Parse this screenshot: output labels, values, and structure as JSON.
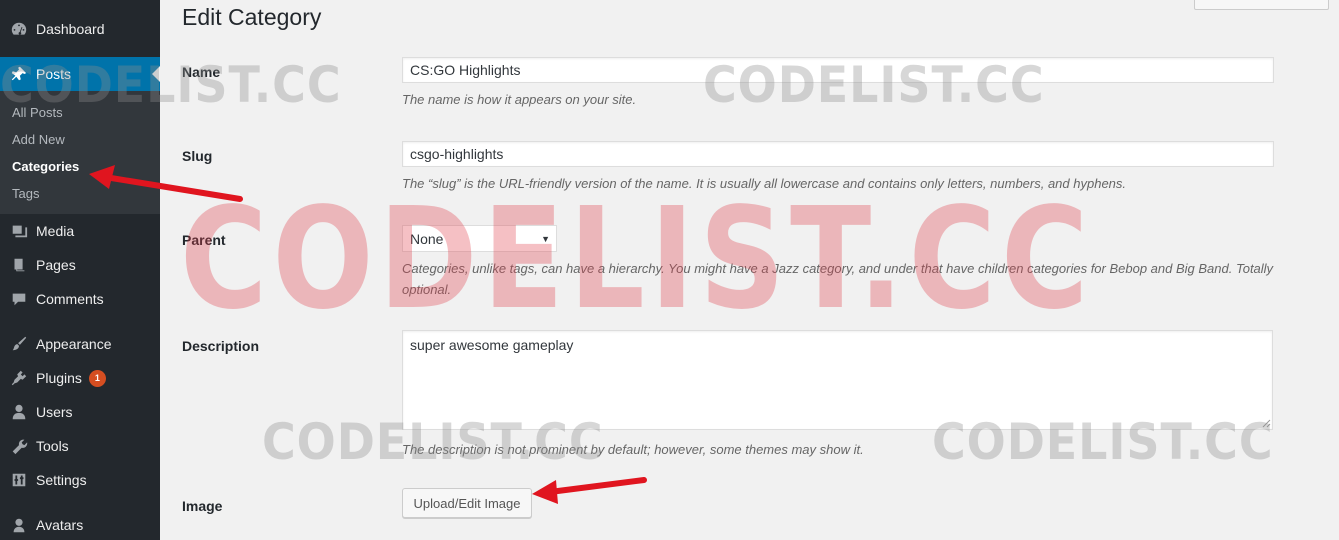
{
  "sidebar": {
    "items": [
      {
        "label": "Dashboard",
        "icon": "dashboard-icon"
      },
      {
        "label": "Posts",
        "icon": "pushpin-icon"
      },
      {
        "label": "Media",
        "icon": "media-icon"
      },
      {
        "label": "Pages",
        "icon": "pages-icon"
      },
      {
        "label": "Comments",
        "icon": "comment-icon"
      },
      {
        "label": "Appearance",
        "icon": "paintbrush-icon"
      },
      {
        "label": "Plugins",
        "icon": "plugin-icon",
        "badge": "1"
      },
      {
        "label": "Users",
        "icon": "user-icon"
      },
      {
        "label": "Tools",
        "icon": "wrench-icon"
      },
      {
        "label": "Settings",
        "icon": "settings-icon"
      },
      {
        "label": "Avatars",
        "icon": "avatar-icon"
      }
    ],
    "submenu": [
      "All Posts",
      "Add New",
      "Categories",
      "Tags"
    ]
  },
  "page": {
    "title": "Edit Category"
  },
  "form": {
    "name_label": "Name",
    "name_value": "CS:GO Highlights",
    "name_help": "The name is how it appears on your site.",
    "slug_label": "Slug",
    "slug_value": "csgo-highlights",
    "slug_help": "The “slug” is the URL-friendly version of the name. It is usually all lowercase and contains only letters, numbers, and hyphens.",
    "parent_label": "Parent",
    "parent_value": "None",
    "parent_help_line1": "Categories, unlike tags, can have a hierarchy. You might have a Jazz category, and under that have children categories for Bebop and Big Band. Totally",
    "parent_help_line2": "optional.",
    "description_label": "Description",
    "description_value": "super awesome gameplay",
    "description_help": "The description is not prominent by default; however, some themes may show it.",
    "image_label": "Image",
    "upload_button": "Upload/Edit Image"
  },
  "watermark": {
    "text": "CODELIST.CC"
  },
  "colors": {
    "sidebar_bg": "#23282d",
    "active_bg": "#0073aa",
    "badge": "#d54e21",
    "arrow": "#e0151f"
  }
}
